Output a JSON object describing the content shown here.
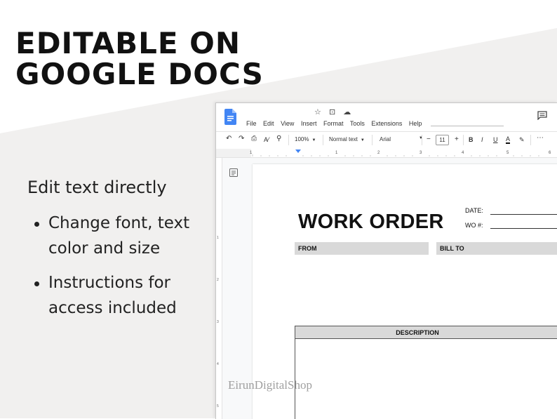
{
  "headline": {
    "line1": "EDITABLE ON",
    "line2": "GOOGLE DOCS"
  },
  "features": {
    "lead": "Edit text directly",
    "bullets": [
      "Change font, text color and size",
      "Instructions for access included"
    ]
  },
  "app": {
    "menu": [
      "File",
      "Edit",
      "View",
      "Insert",
      "Format",
      "Tools",
      "Extensions",
      "Help"
    ],
    "toolbar": {
      "zoom": "100%",
      "style": "Normal text",
      "font": "Arial",
      "size": "11",
      "minus": "−",
      "plus": "+",
      "bold": "B",
      "italic": "I",
      "underline": "U",
      "text_color": "A"
    },
    "ruler_numbers": [
      "1",
      "1",
      "2",
      "3",
      "4",
      "5",
      "6"
    ],
    "left_ruler_numbers": [
      "1",
      "2",
      "3",
      "4",
      "5"
    ]
  },
  "document": {
    "title": "WORK ORDER",
    "date_label": "DATE:",
    "wo_label": "WO #:",
    "from_label": "FROM",
    "bill_to_label": "BILL TO",
    "description_label": "DESCRIPTION"
  },
  "watermark": "EirunDigitalShop",
  "colors": {
    "docs_blue": "#4285f4",
    "band_gray": "#d9d9d9",
    "background_shape": "#f1f0ef"
  }
}
